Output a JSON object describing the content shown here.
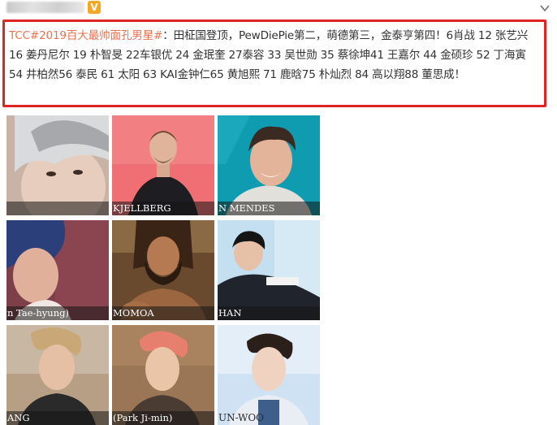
{
  "header": {
    "badge_text": "V",
    "badge_color": "#f5a623",
    "chevron": "chevron-down-icon"
  },
  "post": {
    "tag_text": "TCC",
    "hashtag_text": "#2019百大最帅面孔男星#",
    "body_text": "：田柾国登顶，PewDiePie第二，萌德第三，金泰亨第四！6肖战 12 张艺兴 16 姜丹尼尔 19 朴智旻 22车银优 24 金珉奎 27泰容 33 吴世勋 35 蔡徐坤41 王嘉尔 44 金硕珍 52 丁海寅 54 井柏然56 泰民 61 太阳 63 KAI金钟仁65 黄旭熙 71 鹿晗75 朴灿烈 84 高以翔88 董思成！",
    "highlight_color": "#e02424",
    "link_color": "#eb7350"
  },
  "photos": [
    {
      "caption": ""
    },
    {
      "caption": "KJELLBERG"
    },
    {
      "caption": "N MENDES"
    },
    {
      "caption": "n Tae-hyung)"
    },
    {
      "caption": "MOMOA"
    },
    {
      "caption": "HAN"
    },
    {
      "caption": "ANG"
    },
    {
      "caption": "(Park Ji-min)"
    },
    {
      "caption": "UN-WOO"
    }
  ]
}
